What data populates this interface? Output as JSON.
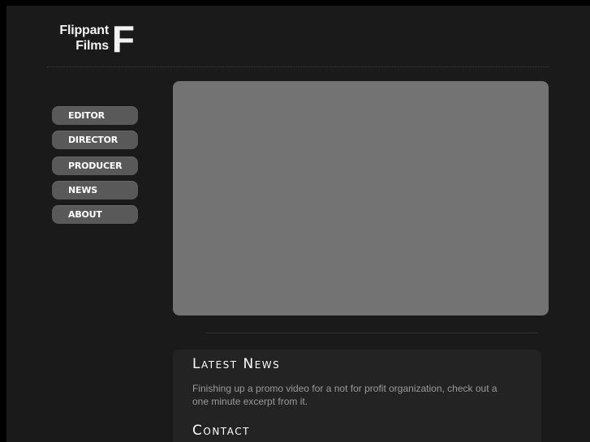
{
  "logo": {
    "line1": "Flippant",
    "line2": "Films",
    "letter": "F"
  },
  "nav": {
    "items": [
      {
        "label": "EDITOR"
      },
      {
        "label": "DIRECTOR"
      },
      {
        "label": "PRODUCER"
      },
      {
        "label": "NEWS"
      },
      {
        "label": "ABOUT"
      }
    ]
  },
  "news": {
    "title": "Latest News",
    "body": "Finishing up a promo video for a not for profit organization, check out a one minute excerpt from it."
  },
  "contact": {
    "title": "Contact"
  },
  "colors": {
    "page_background": "#1a1a1a",
    "outer_background": "#000000",
    "nav_button": "#595959",
    "video_placeholder": "#737373",
    "panel": "#232323",
    "body_text": "#9a9a9a"
  }
}
